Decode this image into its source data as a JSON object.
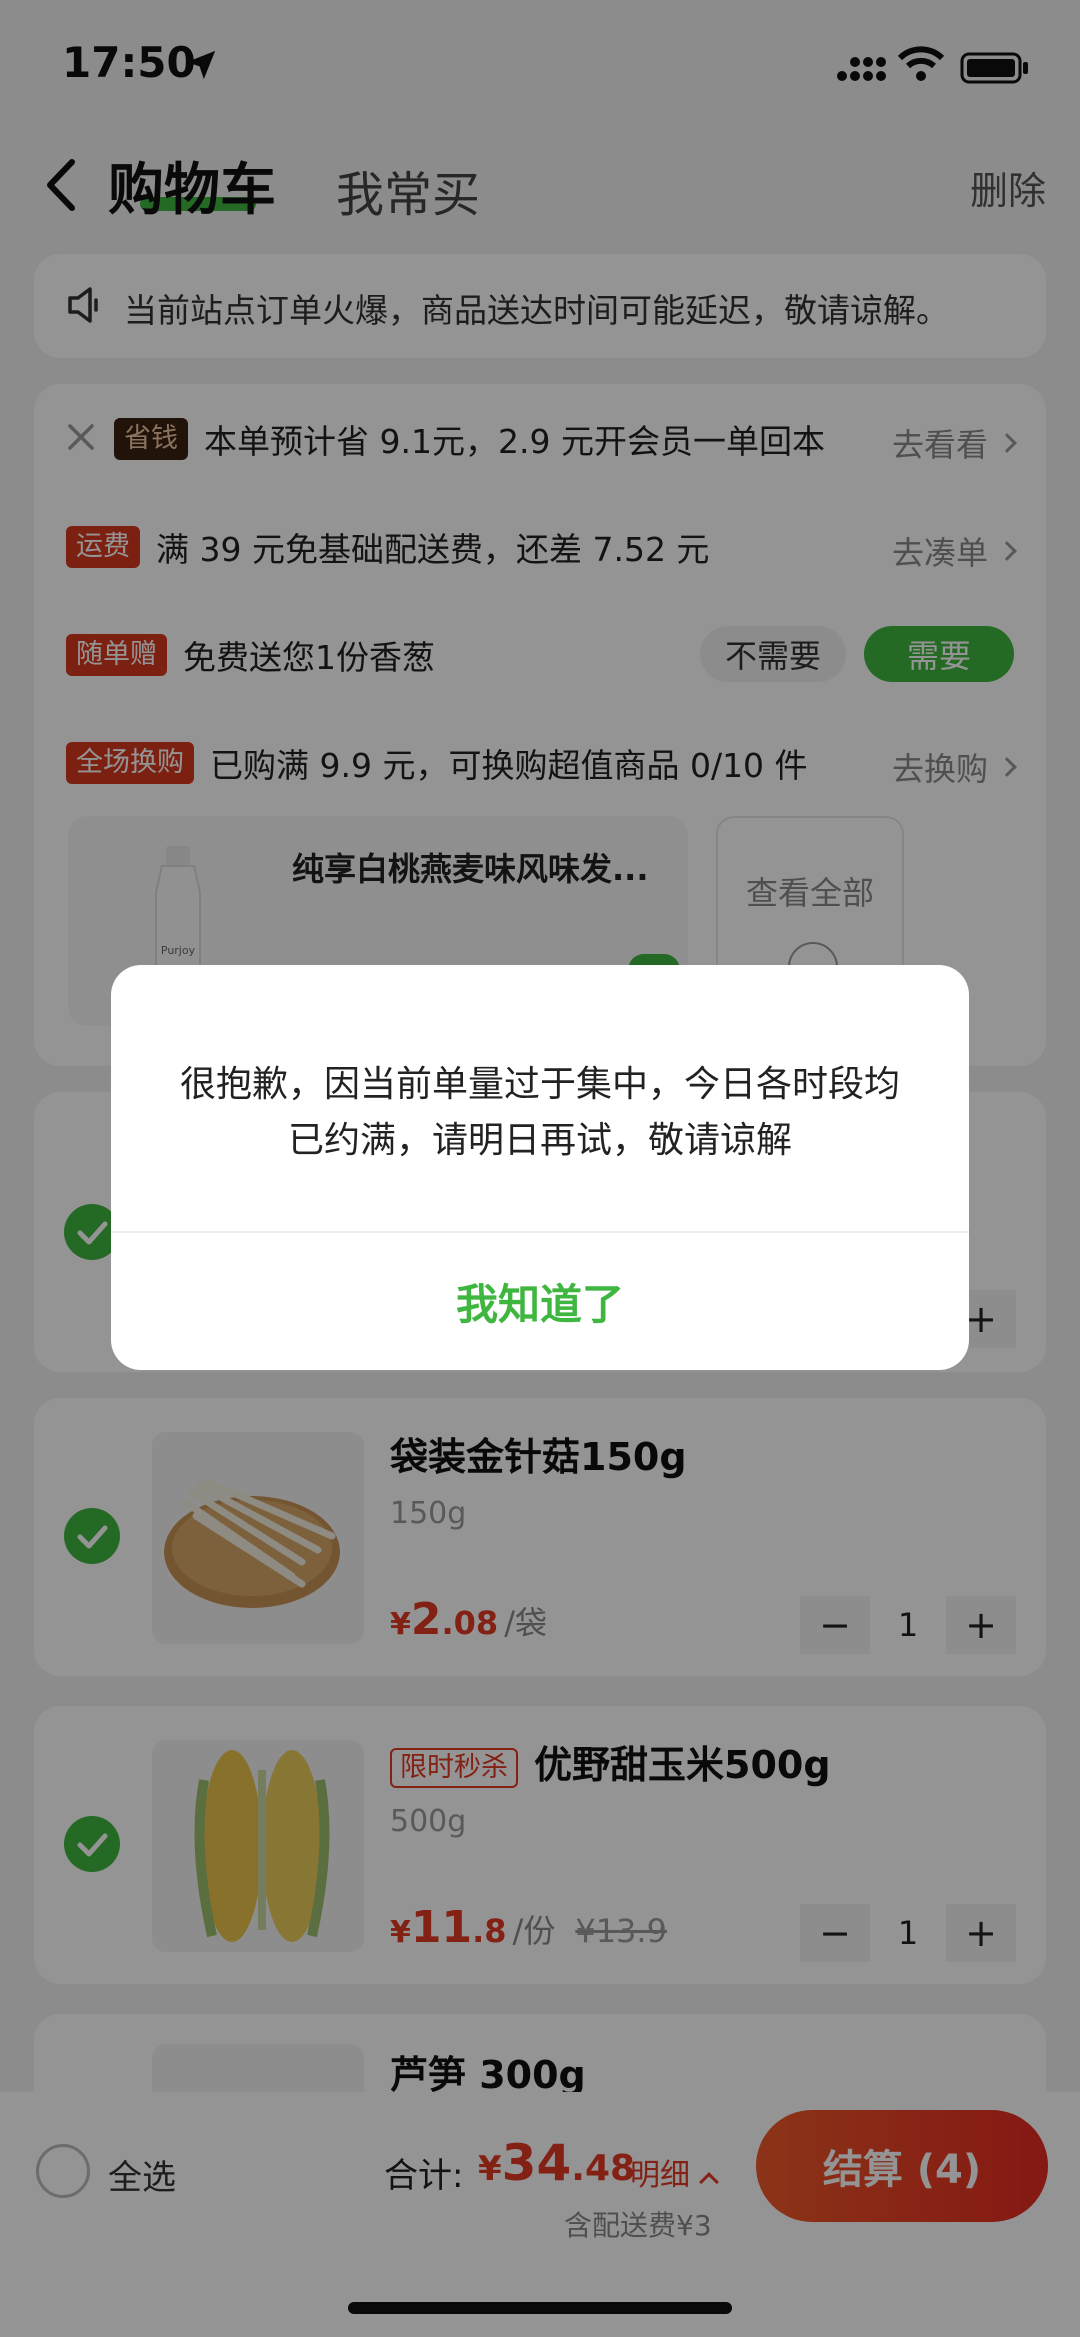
{
  "status_bar": {
    "time": "17:50"
  },
  "header": {
    "tab_cart": "购物车",
    "tab_frequent": "我常买",
    "delete": "删除"
  },
  "notice": {
    "text": "当前站点订单火爆，商品送达时间可能延迟，敬请谅解。"
  },
  "promos": {
    "savings": {
      "tag": "省钱",
      "text": "本单预计省 9.1元，2.9 元开会员一单回本",
      "link": "去看看"
    },
    "shipping": {
      "tag": "运费",
      "text": "满 39 元免基础配送费，还差 7.52 元",
      "link": "去凑单"
    },
    "gift": {
      "tag": "随单赠",
      "text": "免费送您1份香葱",
      "decline": "不需要",
      "accept": "需要"
    },
    "exchange": {
      "tag": "全场换购",
      "text": "已购满 9.9 元，可换购超值商品 0/10 件",
      "link": "去换购"
    },
    "mini_product": {
      "name": "纯享白桃燕麦味风味发...",
      "brand": "Purjoy"
    },
    "view_all": "查看全部"
  },
  "items": [
    {
      "name": "袋装金针菇150g",
      "spec": "150g",
      "price_symbol": "¥",
      "price_int": "2",
      "price_dec": ".08",
      "unit": "/袋",
      "qty": "1"
    },
    {
      "tag": "限时秒杀",
      "name": "优野甜玉米500g",
      "spec": "500g",
      "price_symbol": "¥",
      "price_int": "11",
      "price_dec": ".8",
      "unit": "/份",
      "orig": "¥13.9",
      "qty": "1"
    },
    {
      "name": "芦笋 300g"
    }
  ],
  "bottom": {
    "select_all": "全选",
    "total_label": "合计:",
    "price_symbol": "¥",
    "price_int": "34",
    "price_dec": ".48",
    "detail": "明细",
    "fee": "含配送费¥3",
    "checkout": "结算 (4)"
  },
  "dialog": {
    "message": "很抱歉，因当前单量过于集中，今日各时段均已约满，请明日再试，敬请谅解",
    "button": "我知道了"
  },
  "colors": {
    "accent_green": "#3fb63f",
    "price_red": "#e33a25"
  }
}
